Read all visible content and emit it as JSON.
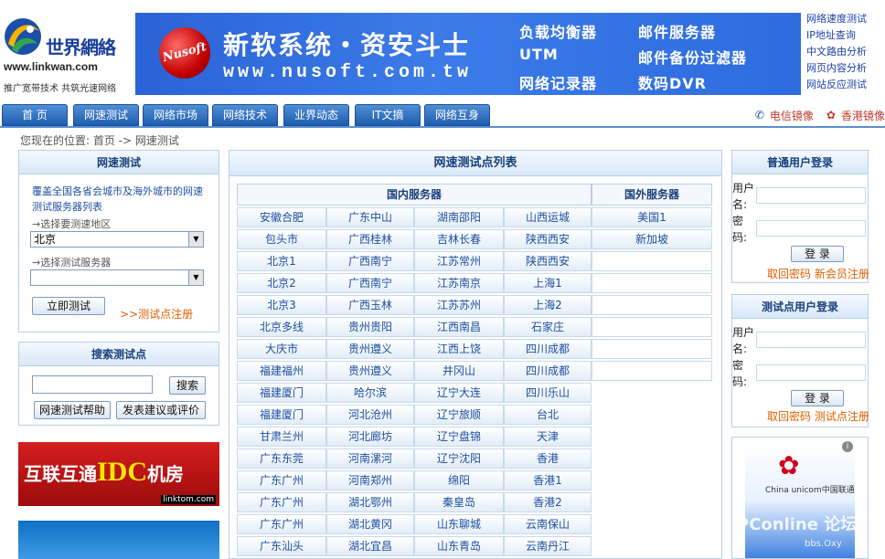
{
  "logo": {
    "name": "世界網絡",
    "url": "www.linkwan.com",
    "slogan": "推广宽带技术 共筑光速网络"
  },
  "banner": {
    "brand": "Nusoft",
    "title": "新软系统・资安斗士",
    "url": "www.nusoft.com.tw",
    "features": [
      "负载均衡器",
      "邮件服务器",
      "UTM",
      "邮件备份过滤器",
      "网络记录器",
      "数码DVR"
    ]
  },
  "quick_links": [
    "网络速度测试",
    "IP地址查询",
    "中文路由分析",
    "网页内容分析",
    "网站反应测试"
  ],
  "nav": {
    "tabs": [
      "首 页",
      "网速测试",
      "网络市场",
      "网络技术",
      "业界动态",
      "IT文摘",
      "网络互身"
    ],
    "mirrors": [
      "电信镜像",
      "香港镜像"
    ]
  },
  "breadcrumb": "您现在的位置: 首页 -> 网速测试",
  "speed_test": {
    "title": "网速测试",
    "description": "覆盖全国各省会城市及海外城市的网速测试服务器列表",
    "region_hint": "→选择要测速地区",
    "region_value": "北京",
    "server_hint": "→选择测试服务器",
    "server_value": "",
    "start_button": "立即测试",
    "register_link": ">>测试点注册"
  },
  "search": {
    "title": "搜索测试点",
    "button": "搜索",
    "help_button": "网速测试帮助",
    "feedback_button": "发表建议或评价"
  },
  "ads": {
    "idc_text": "互联互通",
    "idc_highlight": "IDC",
    "idc_suffix": "机房",
    "idc_url": "linktom.com",
    "unicom_logo": "✿",
    "unicom_text": "China unicom中国联通",
    "watermark": "PConline 论坛",
    "watermark_sub": "bbs.Oxy"
  },
  "main_table": {
    "title": "网速测试点列表",
    "domestic_header": "国内服务器",
    "foreign_header": "国外服务器",
    "domestic": [
      [
        "安徽合肥",
        "广东中山",
        "湖南邵阳",
        "山西运城"
      ],
      [
        "包头市",
        "广西桂林",
        "吉林长春",
        "陕西西安"
      ],
      [
        "北京1",
        "广西南宁",
        "江苏常州",
        "陕西西安"
      ],
      [
        "北京2",
        "广西南宁",
        "江苏南京",
        "上海1"
      ],
      [
        "北京3",
        "广西玉林",
        "江苏苏州",
        "上海2"
      ],
      [
        "北京多线",
        "贵州贵阳",
        "江西南昌",
        "石家庄"
      ],
      [
        "大庆市",
        "贵州遵义",
        "江西上饶",
        "四川成都"
      ],
      [
        "福建福州",
        "贵州遵义",
        "井冈山",
        "四川成都"
      ],
      [
        "福建厦门",
        "哈尔滨",
        "辽宁大连",
        "四川乐山"
      ],
      [
        "福建厦门",
        "河北沧州",
        "辽宁旅顺",
        "台北"
      ],
      [
        "甘肃兰州",
        "河北廊坊",
        "辽宁盘锦",
        "天津"
      ],
      [
        "广东东莞",
        "河南漯河",
        "辽宁沈阳",
        "香港"
      ],
      [
        "广东广州",
        "河南郑州",
        "绵阳",
        "香港1"
      ],
      [
        "广东广州",
        "湖北鄂州",
        "秦皇岛",
        "香港2"
      ],
      [
        "广东广州",
        "湖北黄冈",
        "山东聊城",
        "云南保山"
      ],
      [
        "广东汕头",
        "湖北宜昌",
        "山东青岛",
        "云南丹江"
      ]
    ],
    "foreign": [
      "美国1",
      "新加坡",
      "",
      "",
      "",
      "",
      "",
      ""
    ]
  },
  "user_login": {
    "title": "普通用户登录",
    "username_label": "用户名:",
    "password_label": "密 码:",
    "login_button": "登 录",
    "links": "取回密码 新会员注册"
  },
  "point_login": {
    "title": "测试点用户登录",
    "username_label": "用户名:",
    "password_label": "密 码:",
    "login_button": "登 录",
    "links": "取回密码 测试点注册"
  }
}
